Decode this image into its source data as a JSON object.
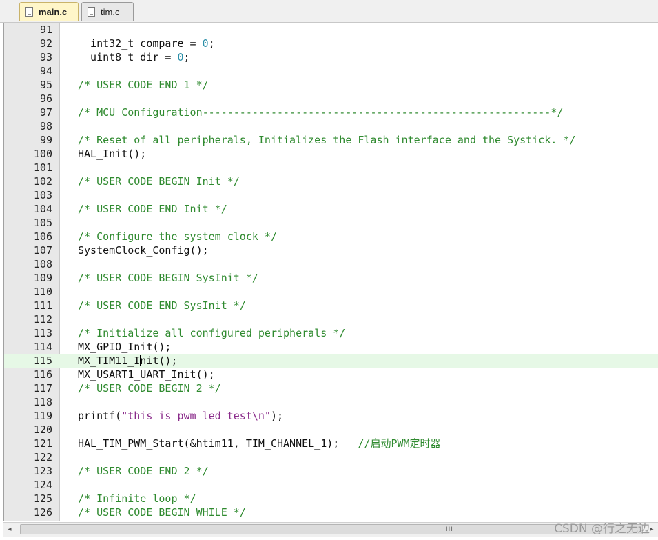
{
  "tabs": [
    {
      "label": "main.c",
      "active": true
    },
    {
      "label": "tim.c",
      "active": false
    }
  ],
  "current_line": "115",
  "lines": [
    {
      "num": "91",
      "tokens": []
    },
    {
      "num": "92",
      "tokens": [
        {
          "t": "  int32_t compare = ",
          "c": "plain"
        },
        {
          "t": "0",
          "c": "num"
        },
        {
          "t": ";",
          "c": "plain"
        }
      ]
    },
    {
      "num": "93",
      "tokens": [
        {
          "t": "  uint8_t dir = ",
          "c": "plain"
        },
        {
          "t": "0",
          "c": "num"
        },
        {
          "t": ";",
          "c": "plain"
        }
      ]
    },
    {
      "num": "94",
      "tokens": []
    },
    {
      "num": "95",
      "tokens": [
        {
          "t": "/* USER CODE END 1 */",
          "c": "comment"
        }
      ]
    },
    {
      "num": "96",
      "tokens": []
    },
    {
      "num": "97",
      "tokens": [
        {
          "t": "/* MCU Configuration--------------------------------------------------------*/",
          "c": "comment"
        }
      ]
    },
    {
      "num": "98",
      "tokens": []
    },
    {
      "num": "99",
      "tokens": [
        {
          "t": "/* Reset of all peripherals, Initializes the Flash interface and the Systick. */",
          "c": "comment"
        }
      ]
    },
    {
      "num": "100",
      "tokens": [
        {
          "t": "HAL_Init();",
          "c": "plain"
        }
      ]
    },
    {
      "num": "101",
      "tokens": []
    },
    {
      "num": "102",
      "tokens": [
        {
          "t": "/* USER CODE BEGIN Init */",
          "c": "comment"
        }
      ]
    },
    {
      "num": "103",
      "tokens": []
    },
    {
      "num": "104",
      "tokens": [
        {
          "t": "/* USER CODE END Init */",
          "c": "comment"
        }
      ]
    },
    {
      "num": "105",
      "tokens": []
    },
    {
      "num": "106",
      "tokens": [
        {
          "t": "/* Configure the system clock */",
          "c": "comment"
        }
      ]
    },
    {
      "num": "107",
      "tokens": [
        {
          "t": "SystemClock_Config();",
          "c": "plain"
        }
      ]
    },
    {
      "num": "108",
      "tokens": []
    },
    {
      "num": "109",
      "tokens": [
        {
          "t": "/* USER CODE BEGIN SysInit */",
          "c": "comment"
        }
      ]
    },
    {
      "num": "110",
      "tokens": []
    },
    {
      "num": "111",
      "tokens": [
        {
          "t": "/* USER CODE END SysInit */",
          "c": "comment"
        }
      ]
    },
    {
      "num": "112",
      "tokens": []
    },
    {
      "num": "113",
      "tokens": [
        {
          "t": "/* Initialize all configured peripherals */",
          "c": "comment"
        }
      ]
    },
    {
      "num": "114",
      "tokens": [
        {
          "t": "MX_GPIO_Init();",
          "c": "plain"
        }
      ]
    },
    {
      "num": "115",
      "tokens": [
        {
          "t": "MX_TIM11_Init();",
          "c": "plain"
        }
      ]
    },
    {
      "num": "116",
      "tokens": [
        {
          "t": "MX_USART1_UART_Init();",
          "c": "plain"
        }
      ]
    },
    {
      "num": "117",
      "tokens": [
        {
          "t": "/* USER CODE BEGIN 2 */",
          "c": "comment"
        }
      ]
    },
    {
      "num": "118",
      "tokens": []
    },
    {
      "num": "119",
      "tokens": [
        {
          "t": "printf(",
          "c": "plain"
        },
        {
          "t": "\"this is pwm led test\\n\"",
          "c": "str"
        },
        {
          "t": ");",
          "c": "plain"
        }
      ]
    },
    {
      "num": "120",
      "tokens": []
    },
    {
      "num": "121",
      "tokens": [
        {
          "t": "HAL_TIM_PWM_Start(&htim11, TIM_CHANNEL_1);   ",
          "c": "plain"
        },
        {
          "t": "//启动PWM定时器",
          "c": "comment"
        }
      ]
    },
    {
      "num": "122",
      "tokens": []
    },
    {
      "num": "123",
      "tokens": [
        {
          "t": "/* USER CODE END 2 */",
          "c": "comment"
        }
      ]
    },
    {
      "num": "124",
      "tokens": []
    },
    {
      "num": "125",
      "tokens": [
        {
          "t": "/* Infinite loop */",
          "c": "comment"
        }
      ]
    },
    {
      "num": "126",
      "tokens": [
        {
          "t": "/* USER CODE BEGIN WHILE */",
          "c": "comment"
        }
      ]
    }
  ],
  "scrollbar": {
    "left_arrow": "◂",
    "right_arrow": "▸",
    "grip": "III"
  },
  "watermark": "CSDN @行之无边"
}
